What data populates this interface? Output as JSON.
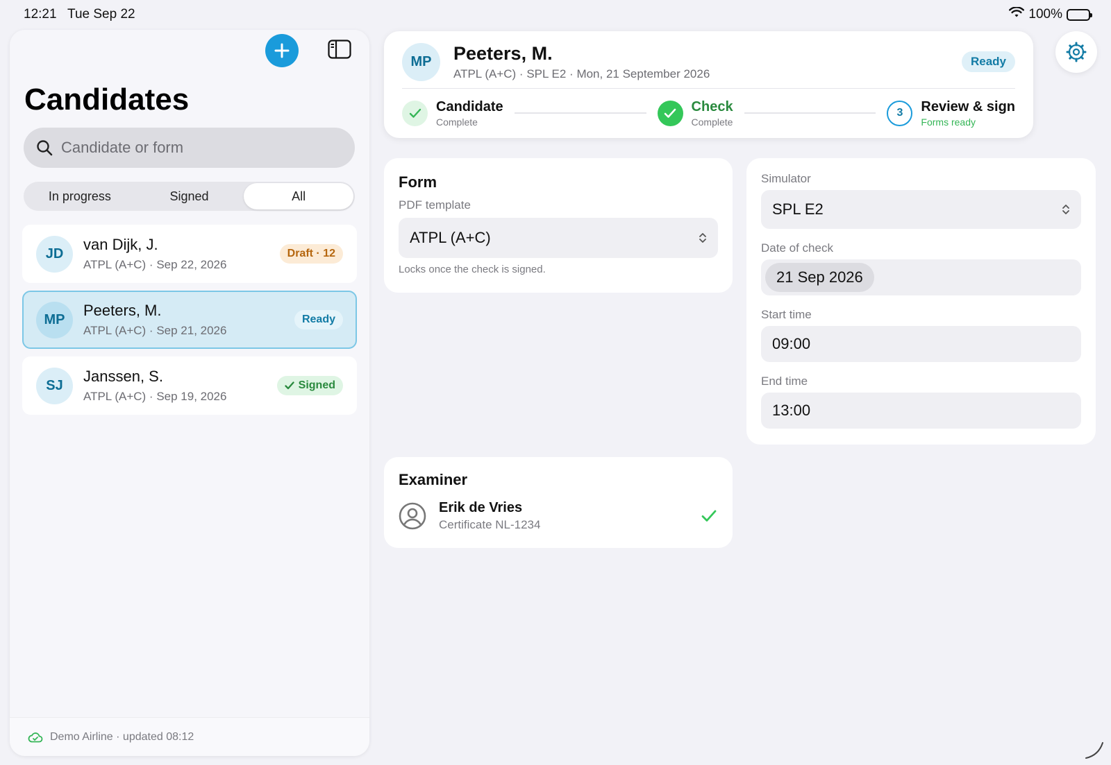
{
  "status_bar": {
    "time": "12:21",
    "date": "Tue Sep 22",
    "battery": "100%"
  },
  "sidebar": {
    "title": "Candidates",
    "search": {
      "placeholder": "Candidate or form"
    },
    "segments": [
      "In progress",
      "Signed",
      "All"
    ],
    "active_segment": "All",
    "candidates": [
      {
        "initials": "JD",
        "name": "van Dijk, J.",
        "subtitle": "ATPL (A+C) · Sep 22, 2026",
        "badge": "Draft · 12",
        "status": "draft"
      },
      {
        "initials": "MP",
        "name": "Peeters, M.",
        "subtitle": "ATPL (A+C) · Sep 21, 2026",
        "badge": "Ready",
        "status": "ready",
        "selected": true
      },
      {
        "initials": "SJ",
        "name": "Janssen, S.",
        "subtitle": "ATPL (A+C) · Sep 19, 2026",
        "badge": "Signed",
        "status": "signed"
      }
    ],
    "footer": "Demo Airline · updated 08:12"
  },
  "header": {
    "initials": "MP",
    "name": "Peeters, M.",
    "subtitle": "ATPL (A+C) · SPL E2 · Mon, 21 September 2026",
    "badge": "Ready",
    "steps": [
      {
        "title": "Candidate",
        "subtitle": "Complete"
      },
      {
        "title": "Check",
        "subtitle": "Complete"
      },
      {
        "number": "3",
        "title": "Review & sign",
        "subtitle": "Forms ready"
      }
    ]
  },
  "form_card": {
    "title": "Form",
    "label": "PDF template",
    "value": "ATPL (A+C)",
    "hint": "Locks once the check is signed."
  },
  "sim_card": {
    "simulator_label": "Simulator",
    "simulator_value": "SPL E2",
    "date_label": "Date of check",
    "date_value": "21 Sep 2026",
    "start_label": "Start time",
    "start_value": "09:00",
    "end_label": "End time",
    "end_value": "13:00"
  },
  "examiner_card": {
    "title": "Examiner",
    "name": "Erik de Vries",
    "certificate": "Certificate NL-1234"
  },
  "colors": {
    "accent": "#1a9bdb",
    "success": "#34c759",
    "draft": "#b5660e"
  }
}
